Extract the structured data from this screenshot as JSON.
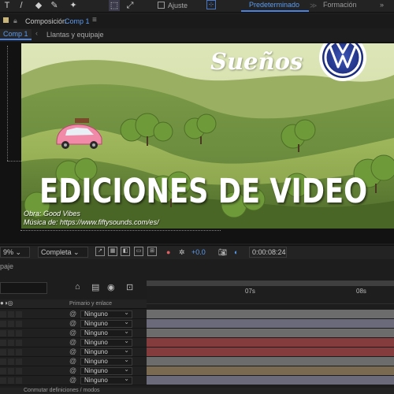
{
  "toolbar": {
    "ajuste_label": "Ajuste",
    "workspace_active": "Predeterminado",
    "workspace_separator": "≫",
    "workspace_other": "Formación",
    "workspace_more": "»"
  },
  "composition_panel": {
    "title_prefix": "Composición",
    "title_comp": "Comp 1",
    "menu_glyph": "≡",
    "tab_active": "Comp 1",
    "tab_arrow": "‹",
    "breadcrumb": "Llantas y equipaje"
  },
  "scene": {
    "title": "Sueños",
    "headline": "EDICIONES DE VIDEO",
    "credit_line1": "Obra: Good Vibes",
    "credit_line2": "Música de: https://www.fiftysounds.com/es/",
    "logo": "vw-logo"
  },
  "viewer_bar": {
    "zoom": "9%",
    "quality": "Completa",
    "exposure": "+0.0",
    "timecode": "0:00:08:24"
  },
  "timeline": {
    "panel_label": "paje",
    "column_header": "Primario y enlace",
    "ticks": [
      "07s",
      "08s"
    ],
    "rows": [
      {
        "parent": "Ninguno",
        "color": "#6c6c6c"
      },
      {
        "parent": "Ninguno",
        "color": "#6a6a7a"
      },
      {
        "parent": "Ninguno",
        "color": "#6c6c6c"
      },
      {
        "parent": "Ninguno",
        "color": "#843c3c"
      },
      {
        "parent": "Ninguno",
        "color": "#843c3c"
      },
      {
        "parent": "Ninguno",
        "color": "#6c6c6c"
      },
      {
        "parent": "Ninguno",
        "color": "#7a6a52"
      },
      {
        "parent": "Ninguno",
        "color": "#6a6a7a"
      }
    ],
    "bottom_text": "Conmutar definiciones / modos"
  },
  "colors": {
    "accent": "#4a84e0",
    "red_layer": "#843c3c",
    "gray_layer": "#6c6c6c"
  }
}
